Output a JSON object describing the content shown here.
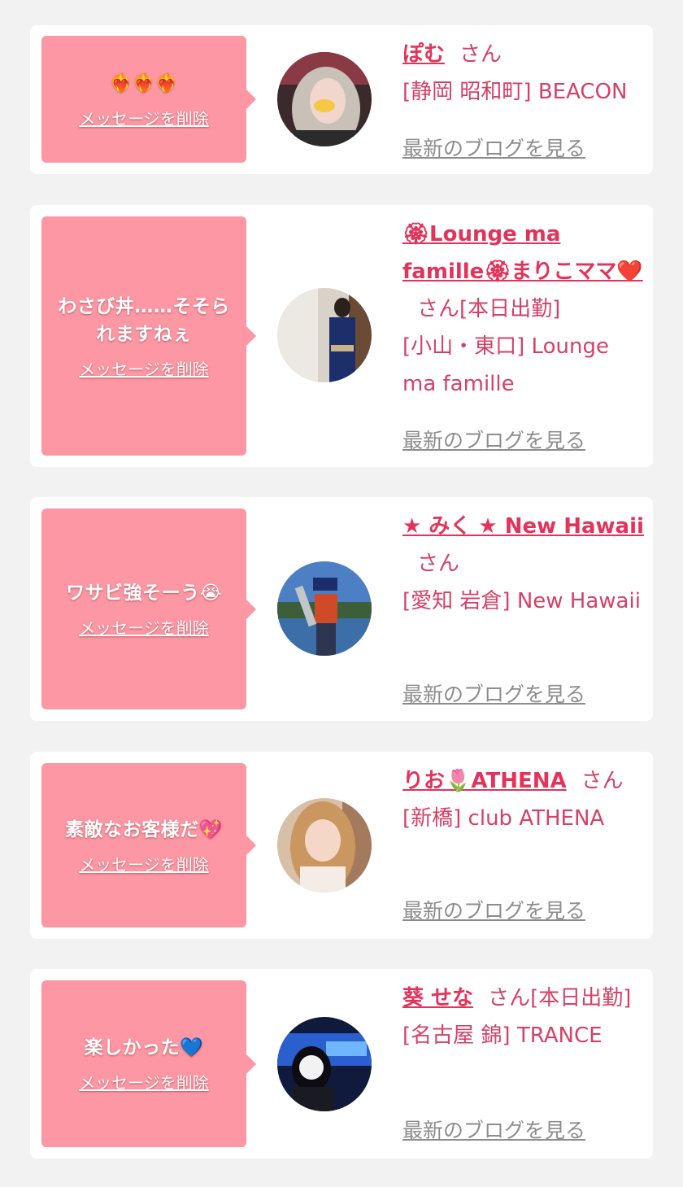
{
  "delete_label": "メッセージを削除",
  "blog_label": "最新のブログを見る",
  "colors": {
    "background": "#f2f2f2",
    "bubble": "#fd97a3",
    "name": "#e4335a",
    "text": "#d54166",
    "link_gray": "#8d8d8d"
  },
  "messages": [
    {
      "message": "❤️‍🔥❤️‍🔥❤️‍🔥",
      "name": "ぽむ",
      "honorific": "さん",
      "shop": "[静岡 昭和町] BEACON"
    },
    {
      "message": "わさび丼……そそられますねぇ",
      "name": "🏵Lounge ma famille🏵まりこママ❤️",
      "honorific": "さん[本日出勤]",
      "shop": "[小山・東口] Lounge ma famille"
    },
    {
      "message": "ワサビ強そーう😭",
      "name": "★ みく ★ New Hawaii",
      "honorific": "さん",
      "shop": "[愛知 岩倉] New Hawaii"
    },
    {
      "message": "素敵なお客様だ💖",
      "name": "りお🌷ATHENA",
      "honorific": "さん",
      "shop": "[新橋] club ATHENA"
    },
    {
      "message": "楽しかった💙",
      "name": "葵 せな",
      "honorific": "さん[本日出勤]",
      "shop": "[名古屋 錦] TRANCE"
    }
  ]
}
